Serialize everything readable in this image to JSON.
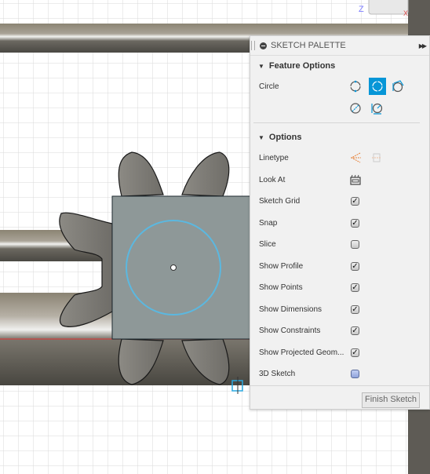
{
  "viewcube": {
    "axis_z": "Z",
    "axis_x": "X"
  },
  "palette": {
    "title": "SKETCH PALETTE",
    "feature_options": {
      "label": "Feature Options",
      "circle_label": "Circle",
      "circle_tools": [
        "center-diameter-circle-icon",
        "two-point-circle-icon",
        "three-point-circle-icon",
        "two-tangent-circle-icon",
        "three-tangent-circle-icon"
      ],
      "selected_tool": "two-point-circle-icon"
    },
    "options": {
      "label": "Options",
      "linetype": "Linetype",
      "look_at": "Look At",
      "items": [
        {
          "label": "Sketch Grid",
          "checked": true
        },
        {
          "label": "Snap",
          "checked": true
        },
        {
          "label": "Slice",
          "checked": false
        },
        {
          "label": "Show Profile",
          "checked": true
        },
        {
          "label": "Show Points",
          "checked": true
        },
        {
          "label": "Show Dimensions",
          "checked": true
        },
        {
          "label": "Show Constraints",
          "checked": true
        },
        {
          "label": "Show Projected Geom...",
          "checked": true
        },
        {
          "label": "3D Sketch",
          "checked": false
        }
      ]
    },
    "finish_label": "Finish Sketch"
  },
  "colors": {
    "accent": "#0696d7",
    "sketch_circle": "#5bb8e0",
    "profile": "#8e9898",
    "axis_red": "#d04040"
  }
}
